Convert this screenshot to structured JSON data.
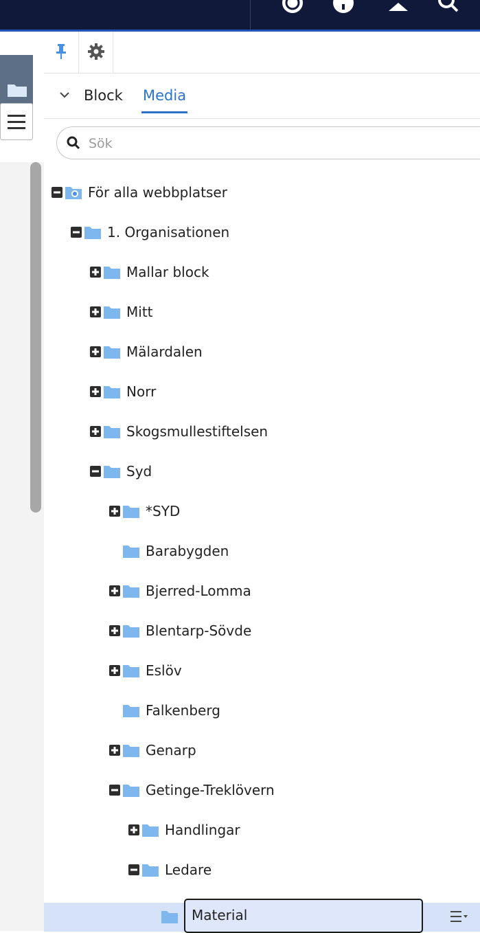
{
  "colors": {
    "topbar": "#10193a",
    "accent": "#2b73c9",
    "folder": "#7eb6ee",
    "selected_row": "#d6e2f8"
  },
  "topbar": {
    "icons": [
      "globe-icon",
      "info-icon",
      "user-icon",
      "search-icon"
    ]
  },
  "toolbar": {
    "pin_icon": "pin-icon",
    "settings_icon": "gear-icon"
  },
  "tabs": {
    "block": "Block",
    "media": "Media",
    "active": "Media"
  },
  "search": {
    "placeholder": "Sök",
    "value": ""
  },
  "tree": {
    "root": "För alla webbplatser",
    "org": "1. Organisationen",
    "items": {
      "mallar": "Mallar block",
      "mitt": "Mitt",
      "malardalen": "Mälardalen",
      "norr": "Norr",
      "skogsmulle": "Skogsmullestiftelsen",
      "syd": "Syd",
      "syd_star": "*SYD",
      "barabygden": "Barabygden",
      "bjerred": "Bjerred-Lomma",
      "blentarp": "Blentarp-Sövde",
      "eslov": "Eslöv",
      "falkenberg": "Falkenberg",
      "genarp": "Genarp",
      "getinge": "Getinge-Treklövern",
      "handlingar": "Handlingar",
      "ledare": "Ledare",
      "material": "Material"
    }
  }
}
